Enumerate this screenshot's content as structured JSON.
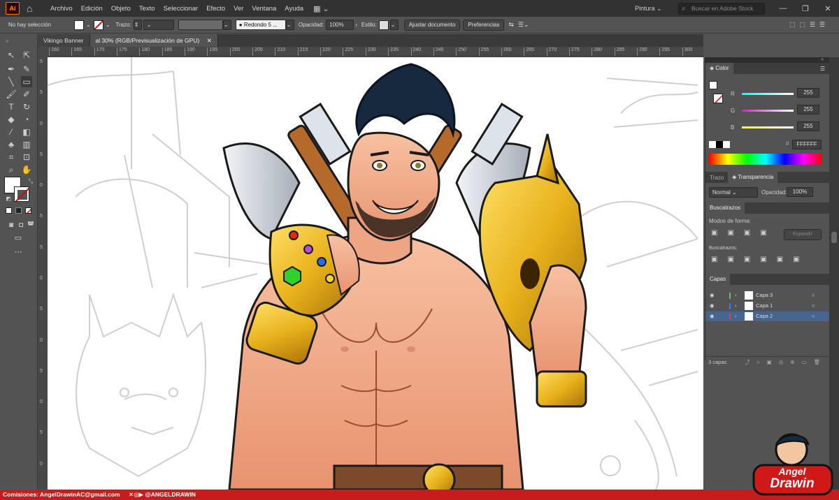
{
  "menubar": {
    "app_icon": "Ai",
    "home_icon": "home-icon",
    "menus": [
      "Archivo",
      "Edición",
      "Objeto",
      "Texto",
      "Seleccionar",
      "Efecto",
      "Ver",
      "Ventana",
      "Ayuda"
    ],
    "workspace": "Pintura",
    "search_placeholder": "Buscar en Adobe Stock"
  },
  "control": {
    "selection": "No hay selección",
    "stroke_label": "Trazo:",
    "brush": "Redondo 5 ...",
    "opacity_label": "Opacidad:",
    "opacity": "100%",
    "style_label": "Estilo:",
    "doc_setup": "Ajustar documento",
    "prefs": "Preferencias"
  },
  "tabs": [
    {
      "label": "Vikingo Banner"
    },
    {
      "label": "al 30% (RGB/Previsualización de GPU)"
    }
  ],
  "ruler_ticks": [
    "160",
    "165",
    "170",
    "175",
    "180",
    "185",
    "190",
    "195",
    "200",
    "205",
    "210",
    "215",
    "220",
    "225",
    "230",
    "235",
    "240",
    "245",
    "250",
    "255",
    "260",
    "265",
    "270",
    "275",
    "280",
    "285",
    "290",
    "295",
    "300"
  ],
  "vruler_ticks": [
    "5",
    "5",
    "0",
    "5",
    "0",
    "5",
    "5",
    "0",
    "5",
    "0",
    "5",
    "0",
    "5",
    "0"
  ],
  "color_panel": {
    "title": "Color",
    "labels": [
      "R",
      "G",
      "B"
    ],
    "values": [
      "255",
      "255",
      "255"
    ],
    "hex": "FFFFFF",
    "colors": {
      "r": "#ff0000",
      "g": "#00ff00",
      "b": "#0000ff"
    }
  },
  "transparency": {
    "tabs": [
      "Trazo",
      "Transparencia"
    ],
    "mode": "Normal",
    "opacity_label": "Opacidad:",
    "opacity": "100%"
  },
  "pathfinder": {
    "title": "Buscatrazos",
    "shape_modes": "Modos de forma:",
    "expand": "Expandir",
    "pathfinders": "Buscatrazos:"
  },
  "layers": {
    "title": "Capas",
    "items": [
      {
        "name": "Capa 3",
        "color": "#4fd14f"
      },
      {
        "name": "Capa 1",
        "color": "#4a6cff"
      },
      {
        "name": "Capa 2",
        "color": "#e04040"
      }
    ],
    "count": "3 capas"
  },
  "footer": {
    "commissions": "Comisiones: AngelDrawinAC@gmail.com",
    "social": "@ANGELDRAWIN"
  },
  "logo": {
    "line1": "Angel",
    "line2": "Drawin"
  }
}
